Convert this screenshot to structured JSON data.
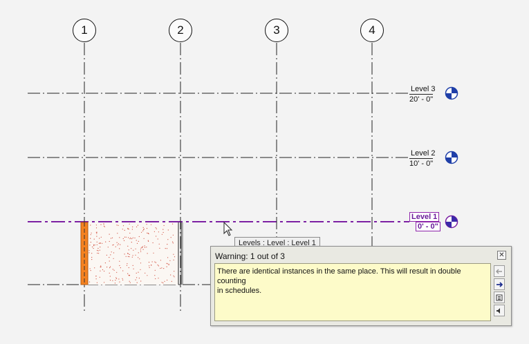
{
  "grids": [
    {
      "label": "1"
    },
    {
      "label": "2"
    },
    {
      "label": "3"
    },
    {
      "label": "4"
    }
  ],
  "levels": [
    {
      "name": "Level 3",
      "elevation": "20' - 0\""
    },
    {
      "name": "Level 2",
      "elevation": "10' - 0\""
    },
    {
      "name": "Level 1",
      "elevation": "0' - 0\"",
      "selected": true
    }
  ],
  "tooltip": {
    "text": "Levels : Level : Level 1"
  },
  "warning": {
    "title": "Warning: 1 out of 3",
    "close_glyph": "✕",
    "message_line1": "There are identical instances in the same place. This will result in double counting",
    "message_line2": "in schedules."
  },
  "colors": {
    "selected_level": "#7b1fa2",
    "wall": "#f58220",
    "level_marker": "#1f3fa8"
  },
  "icons": [
    "previous-arrow-icon",
    "next-arrow-icon",
    "show-elements-icon",
    "sound-icon"
  ]
}
